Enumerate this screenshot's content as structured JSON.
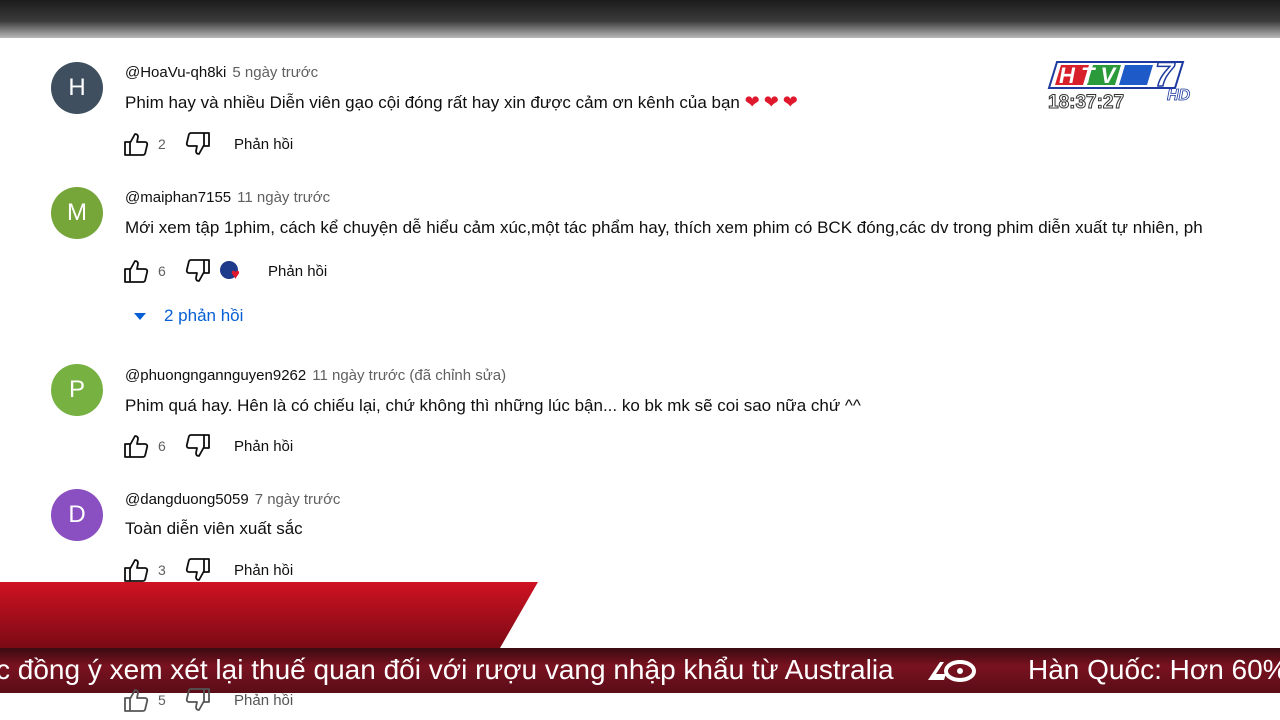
{
  "comments": [
    {
      "avatar_letter": "H",
      "avatar_color": "#3f4f5f",
      "handle": "@HoaVu-qh8ki",
      "time": "5 ngày trước",
      "text": "Phim hay và nhiều Diễn viên gạo cội đóng rất hay xin được cảm ơn kênh của bạn",
      "hearts": "❤❤❤",
      "likes": "2",
      "reply_label": "Phản hồi"
    },
    {
      "avatar_letter": "M",
      "avatar_color": "#76a53a",
      "handle": "@maiphan7155",
      "time": "11 ngày trước",
      "text": "Mới xem tập 1phim, cách kể chuyện dễ hiểu cảm xúc,một tác phẩm hay, thích xem phim có BCK đóng,các dv trong phim diễn xuất tự nhiên, ph",
      "likes": "6",
      "reply_label": "Phản hồi",
      "replies_toggle": "2 phản hồi"
    },
    {
      "avatar_letter": "P",
      "avatar_color": "#76b142",
      "handle": "@phuongngannguyen9262",
      "time": "11 ngày trước (đã chỉnh sửa)",
      "text": "Phim quá hay. Hên là có chiếu lại, chứ không thì những lúc bận... ko bk mk sẽ coi sao nữa chứ ^^",
      "likes": "6",
      "reply_label": "Phản hồi"
    },
    {
      "avatar_letter": "D",
      "avatar_color": "#8a4fc0",
      "handle": "@dangduong5059",
      "time": "7 ngày trước",
      "text": "Toàn diễn viên xuất sắc",
      "likes": "3",
      "reply_label": "Phản hồi"
    },
    {
      "likes": "5",
      "reply_label": "Phản hồi"
    }
  ],
  "overlay": {
    "logo_text": "HTV7",
    "logo_hd": "HD",
    "clock": "18:37:27",
    "ticker_text": "c đồng ý xem xét lại thuế quan đối với rượu vang nhập khẩu từ Australia",
    "ticker_text2": "Hàn Quốc: Hơn 60%"
  },
  "colors": {
    "link_blue": "#065fd4",
    "heart_red": "#e0182d",
    "banner_red": "#c4101c",
    "ticker_bg": "#7a1220"
  }
}
